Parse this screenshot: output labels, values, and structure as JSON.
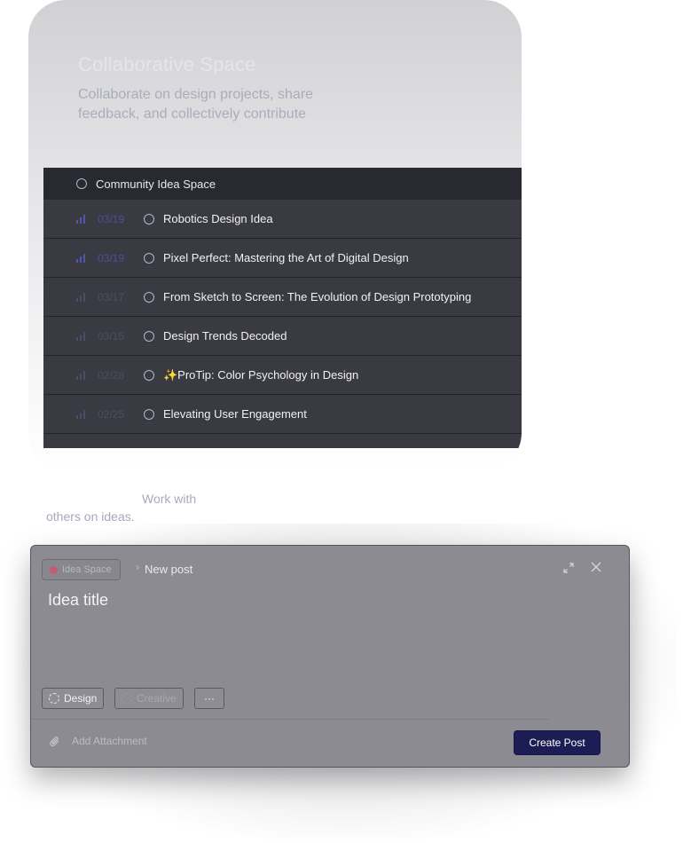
{
  "hero": {
    "title": "Collaborative Space",
    "subtitle": "Collaborate on design projects, share feedback, and collectively contribute"
  },
  "list": {
    "header": "Community Idea Space",
    "rows": [
      {
        "date": "03/19",
        "title": "Robotics Design Idea",
        "dim": false
      },
      {
        "date": "03/19",
        "title": "Pixel Perfect: Mastering the Art of Digital Design",
        "dim": false
      },
      {
        "date": "03/17",
        "title": "From Sketch to Screen: The Evolution of Design Prototyping",
        "dim": true
      },
      {
        "date": "03/15",
        "title": "Design Trends Decoded",
        "dim": true
      },
      {
        "date": "02/28",
        "title": "✨ProTip: Color Psychology in Design",
        "dim": true
      },
      {
        "date": "02/25",
        "title": "Elevating User Engagement",
        "dim": true
      }
    ]
  },
  "caption": {
    "line1": "Work with",
    "line2": "others on ideas."
  },
  "composer": {
    "breadcrumb_space": "Idea Space",
    "breadcrumb_separator": "›",
    "breadcrumb_current": "New post",
    "title_placeholder": "Idea title",
    "tags": {
      "design": "Design",
      "creative": "Creative",
      "more": "···"
    },
    "attachment_label": "Add Attachment",
    "submit_label": "Create Post",
    "colors": {
      "submit_bg": "#1d1d55",
      "space_logo": "#c45a73"
    }
  }
}
